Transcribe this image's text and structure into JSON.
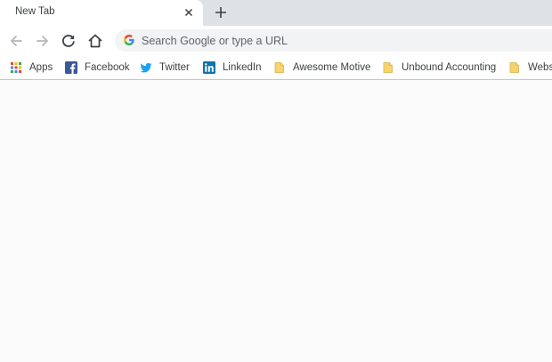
{
  "tab": {
    "title": "New Tab"
  },
  "omnibox": {
    "placeholder": "Search Google or type a URL"
  },
  "bookmarks": [
    {
      "label": "Apps",
      "icon": "apps-grid-icon"
    },
    {
      "label": "Facebook",
      "icon": "facebook-icon"
    },
    {
      "label": "Twitter",
      "icon": "twitter-icon"
    },
    {
      "label": "LinkedIn",
      "icon": "linkedin-icon"
    },
    {
      "label": "Awesome Motive",
      "icon": "folder-icon"
    },
    {
      "label": "Unbound Accounting",
      "icon": "folder-icon"
    },
    {
      "label": "Webs",
      "icon": "folder-icon"
    }
  ],
  "colors": {
    "tabstrip": "#dee1e6",
    "toolbar": "#ffffff",
    "omnibox": "#f1f3f4",
    "page_background": "#fbfbfc",
    "facebook": "#3b5998",
    "twitter": "#1da1f2",
    "linkedin": "#0e76a8",
    "folder": "#f6d46b"
  }
}
